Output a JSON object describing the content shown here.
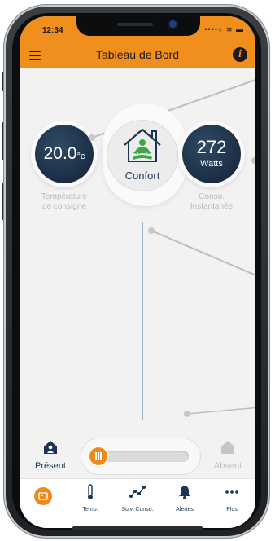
{
  "status": {
    "time": "12:34",
    "icons": "••••○ ≋ ▬"
  },
  "appbar": {
    "title": "Tableau de Bord",
    "info": "i"
  },
  "dashboard": {
    "temperature": {
      "value": "20.0",
      "unit": "°c",
      "label_line1": "Température",
      "label_line2": "de consigne"
    },
    "mode": {
      "label": "Confort"
    },
    "power": {
      "value": "272",
      "unit": "Watts",
      "label_line1": "Conso.",
      "label_line2": "Instantanée"
    }
  },
  "presence": {
    "present_label": "Présent",
    "absent_label": "Absent",
    "slider_value": 0
  },
  "tabs": [
    {
      "label": "",
      "icon": "dashboard-icon",
      "active": true
    },
    {
      "label": "Temp.",
      "icon": "thermometer-icon"
    },
    {
      "label": "Suivi Conso.",
      "icon": "chart-icon"
    },
    {
      "label": "Alertes",
      "icon": "bell-icon"
    },
    {
      "label": "Plus",
      "icon": "more-icon"
    }
  ],
  "colors": {
    "accent": "#f08f1e",
    "navy": "#1b3553",
    "green": "#3aa845"
  }
}
